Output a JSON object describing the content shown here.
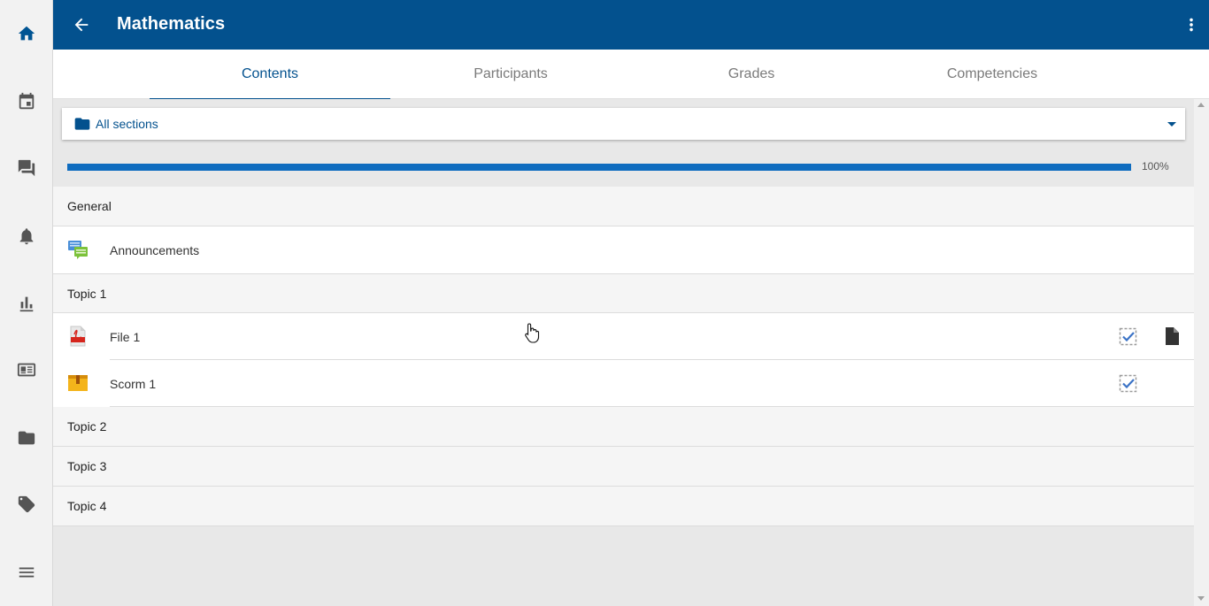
{
  "header": {
    "title": "Mathematics"
  },
  "tabs": [
    {
      "label": "Contents",
      "active": true
    },
    {
      "label": "Participants",
      "active": false
    },
    {
      "label": "Grades",
      "active": false
    },
    {
      "label": "Competencies",
      "active": false
    }
  ],
  "section_selector": {
    "label": "All sections"
  },
  "progress": {
    "percent": 100,
    "text": "100%"
  },
  "sections": [
    {
      "name": "General",
      "modules": [
        {
          "name": "Announcements",
          "icon": "forum-icon",
          "completion": false,
          "download": false
        }
      ]
    },
    {
      "name": "Topic 1",
      "modules": [
        {
          "name": "File 1",
          "icon": "pdf-file-icon",
          "completion": true,
          "download": true
        },
        {
          "name": "Scorm 1",
          "icon": "scorm-package-icon",
          "completion": true,
          "download": false
        }
      ]
    },
    {
      "name": "Topic 2",
      "modules": []
    },
    {
      "name": "Topic 3",
      "modules": []
    },
    {
      "name": "Topic 4",
      "modules": []
    }
  ],
  "rail_icons": [
    "home-icon",
    "calendar-icon",
    "messages-icon",
    "notifications-icon",
    "grades-icon",
    "news-icon",
    "files-icon",
    "tags-icon",
    "menu-icon"
  ],
  "colors": {
    "brand": "#03518e",
    "progress": "#0f6cbf"
  }
}
